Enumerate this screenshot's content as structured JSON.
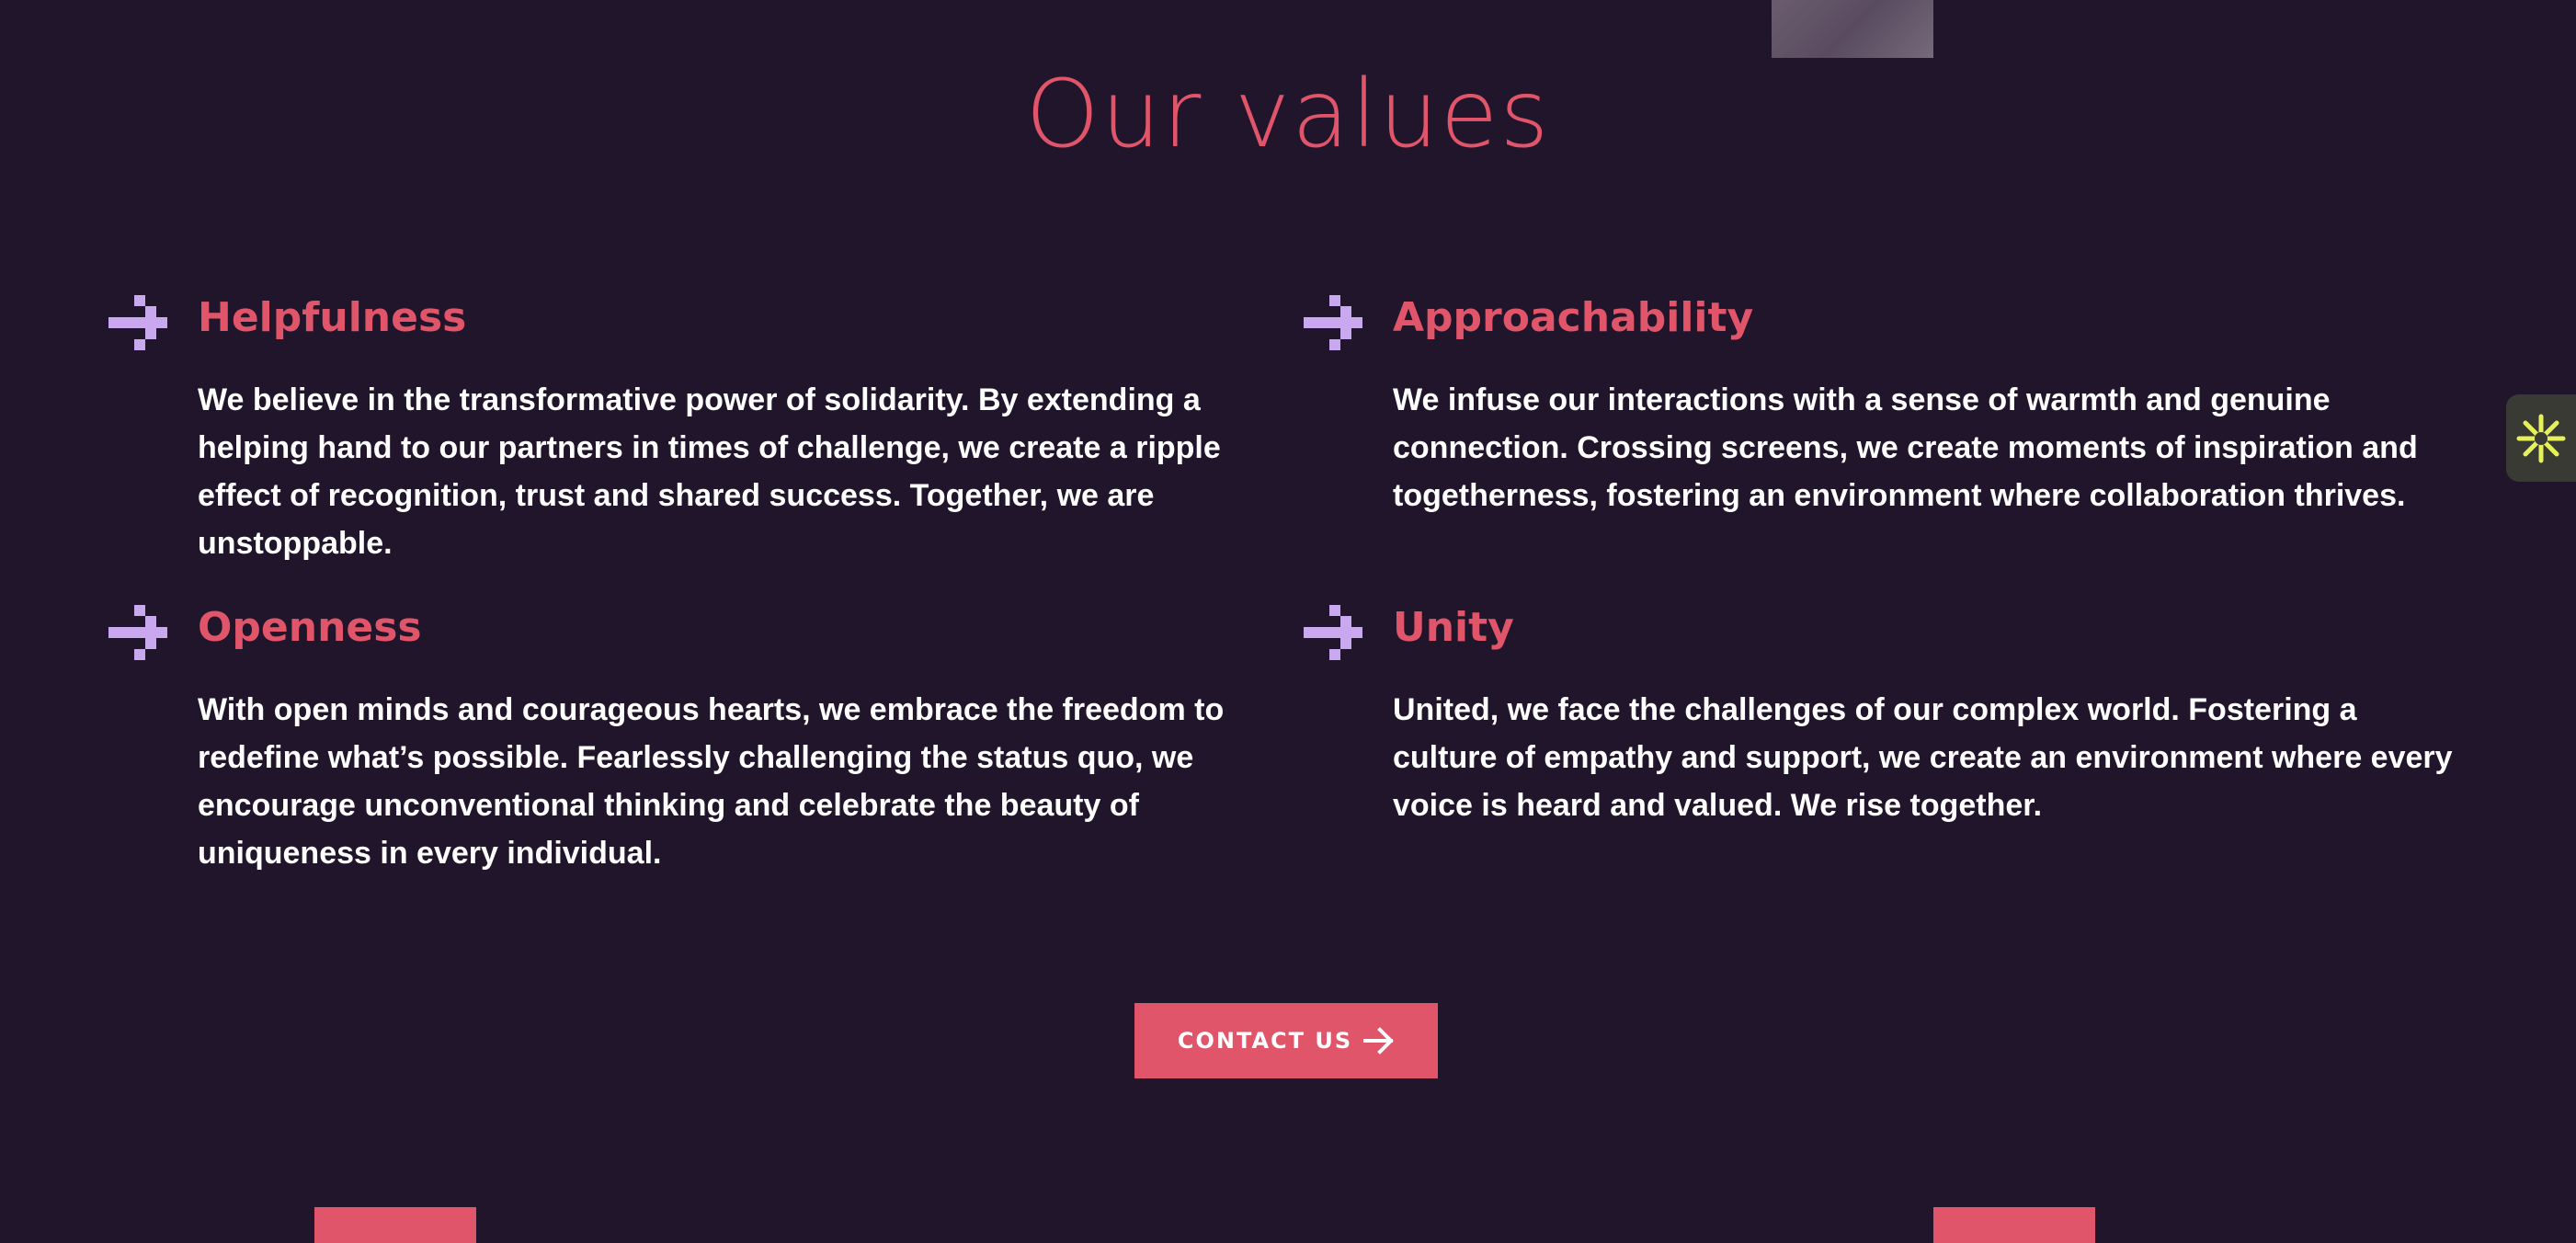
{
  "page": {
    "title": "Our values"
  },
  "values": [
    {
      "title": "Helpfulness",
      "text": "We believe in the transformative power of solidarity. By extending a helping hand to our partners in times of challenge, we create a ripple effect of recognition, trust and shared success. Together, we are unstoppable.",
      "icon": "arrow-right-pixel-icon"
    },
    {
      "title": "Approachability",
      "text": "We infuse our interactions with a sense of warmth and genuine connection. Crossing screens, we create moments of inspiration and togetherness, fostering an environment where collaboration thrives.",
      "icon": "arrow-right-pixel-icon"
    },
    {
      "title": "Openness",
      "text": "With open minds and courageous hearts, we embrace the freedom to redefine what’s possible. Fearlessly challenging the status quo, we encourage unconventional thinking and celebrate the beauty of uniqueness in every individual.",
      "icon": "arrow-right-pixel-icon"
    },
    {
      "title": "Unity",
      "text": "United, we face the challenges of our complex world. Fostering a culture of empathy and support, we create an environment where every voice is heard and valued. We rise together.",
      "icon": "arrow-right-pixel-icon"
    }
  ],
  "cta": {
    "label": "CONTACT US",
    "icon": "arrow-right-icon"
  },
  "widget": {
    "icon": "asterisk-icon"
  },
  "colors": {
    "background": "#21152b",
    "accent": "#e05569",
    "icon": "#c9a8f0",
    "text": "#ffffff",
    "widget_icon": "#e6f05a"
  }
}
